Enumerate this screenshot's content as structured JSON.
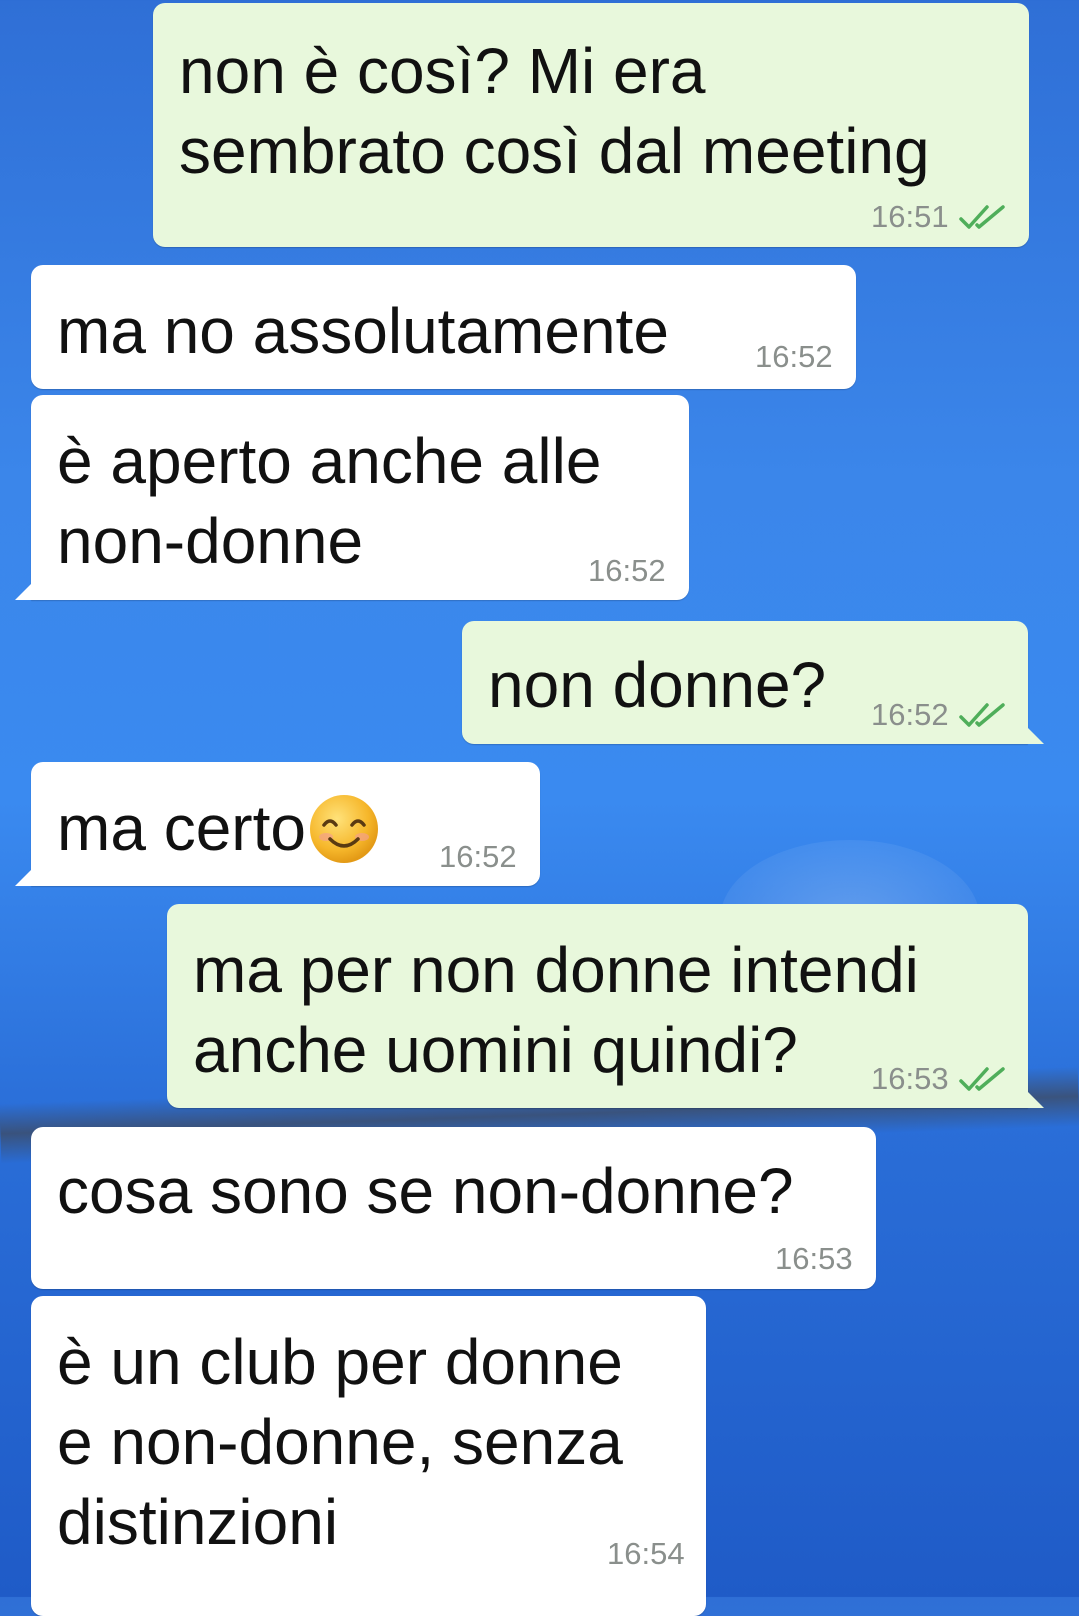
{
  "colors": {
    "incoming_bubble": "#ffffff",
    "outgoing_bubble": "#e8f8dc",
    "read_check": "#4fae5a",
    "timestamp": "#8a8f8c"
  },
  "messages": [
    {
      "direction": "out",
      "lines": [
        "non è così? Mi era",
        "sembrato così dal meeting"
      ],
      "time": "16:51",
      "status": "read"
    },
    {
      "direction": "in",
      "lines": [
        "ma no assolutamente"
      ],
      "time": "16:52"
    },
    {
      "direction": "in",
      "lines": [
        "è aperto anche alle",
        "non-donne"
      ],
      "time": "16:52"
    },
    {
      "direction": "out",
      "lines": [
        "non donne?"
      ],
      "time": "16:52",
      "status": "read"
    },
    {
      "direction": "in",
      "lines": [
        "ma certo"
      ],
      "time": "16:52",
      "emoji": "smiling-face-icon"
    },
    {
      "direction": "out",
      "lines": [
        "ma per non donne intendi",
        "anche uomini quindi?"
      ],
      "time": "16:53",
      "status": "read"
    },
    {
      "direction": "in",
      "lines": [
        "cosa sono se non-donne?"
      ],
      "time": "16:53"
    },
    {
      "direction": "in",
      "lines": [
        "è un club per donne",
        "e non-donne, senza",
        "distinzioni"
      ],
      "time": "16:54"
    }
  ]
}
